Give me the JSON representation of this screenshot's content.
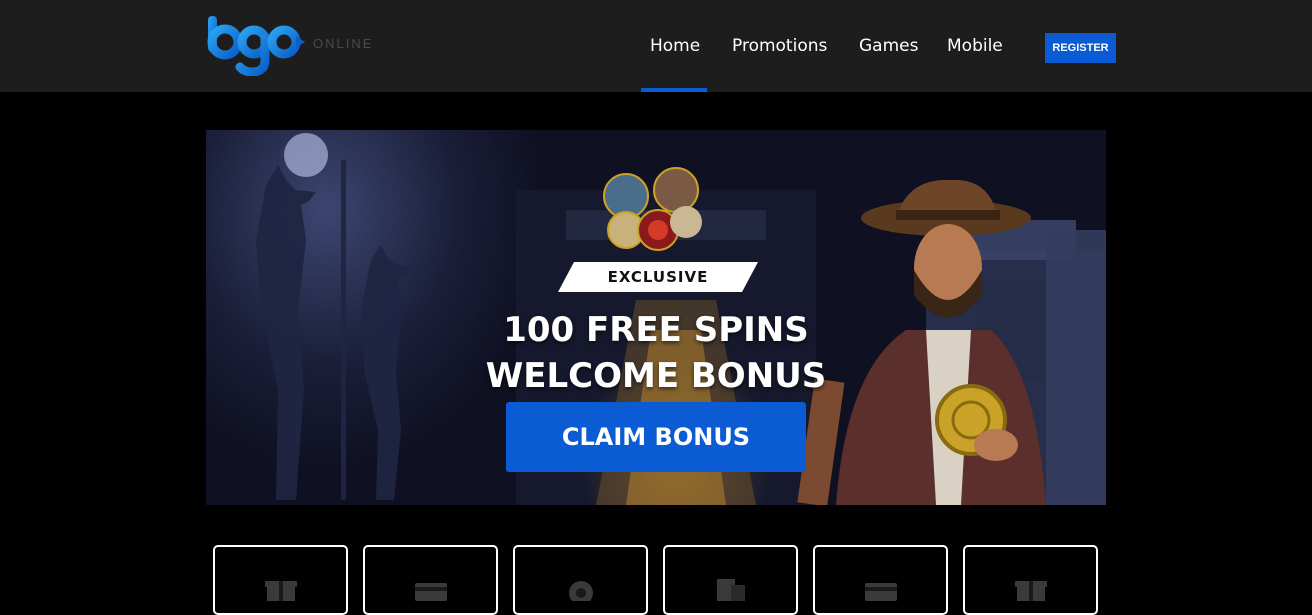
{
  "header": {
    "logo_text": "bgo",
    "logo_sub": "ONLINE",
    "nav": [
      {
        "label": "Home",
        "active": true
      },
      {
        "label": "Promotions",
        "active": false
      },
      {
        "label": "Games",
        "active": false
      },
      {
        "label": "Mobile",
        "active": false
      }
    ],
    "register_label": "REGISTER"
  },
  "banner": {
    "badge": "EXCLUSIVE",
    "line1": "100 FREE SPINS",
    "line2": "WELCOME BONUS",
    "cta_label": "CLAIM BONUS"
  },
  "tiles": [
    {
      "icon": "gift-icon"
    },
    {
      "icon": "card-icon"
    },
    {
      "icon": "chip-icon"
    },
    {
      "icon": "phone-icon"
    },
    {
      "icon": "card-icon"
    },
    {
      "icon": "gift-icon"
    }
  ],
  "colors": {
    "header_bg": "#1d1d1d",
    "accent": "#0b5bd4",
    "page_bg": "#000000",
    "logo_blue": "#1a8ae6"
  }
}
